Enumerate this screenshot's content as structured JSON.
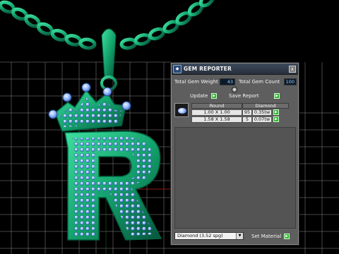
{
  "panel": {
    "title": "GEM REPORTER",
    "close_glyph": "x",
    "total_gem_weight_label": "Total Gem Weight",
    "total_gem_weight_value": "43",
    "total_gem_count_label": "Total Gem Count",
    "total_gem_count_value": "100",
    "update_label": "Update",
    "save_report_label": "Save Report",
    "table": {
      "headers": [
        "Round",
        "Diamond"
      ],
      "rows": [
        {
          "size": "1.00 X 1.00",
          "count": "95",
          "weight": "0.35tw"
        },
        {
          "size": "1.58 X 1.58",
          "count": "5",
          "weight": "0.07tw"
        }
      ]
    },
    "material_selected": "Diamond    (3.52 spg)",
    "set_material_label": "Set Material"
  },
  "colors": {
    "metal": "#1a9e6a",
    "gem": "#8fb4ff",
    "grid": "#ffffff",
    "panel_bg": "#5e5e5e",
    "go_button": "#2db32d"
  },
  "icons": {
    "app": "gem-reporter-icon",
    "close": "close-icon",
    "go": "play-arrow-icon",
    "collapse": "collapse-icon",
    "dropdown": "chevron-down-icon"
  }
}
